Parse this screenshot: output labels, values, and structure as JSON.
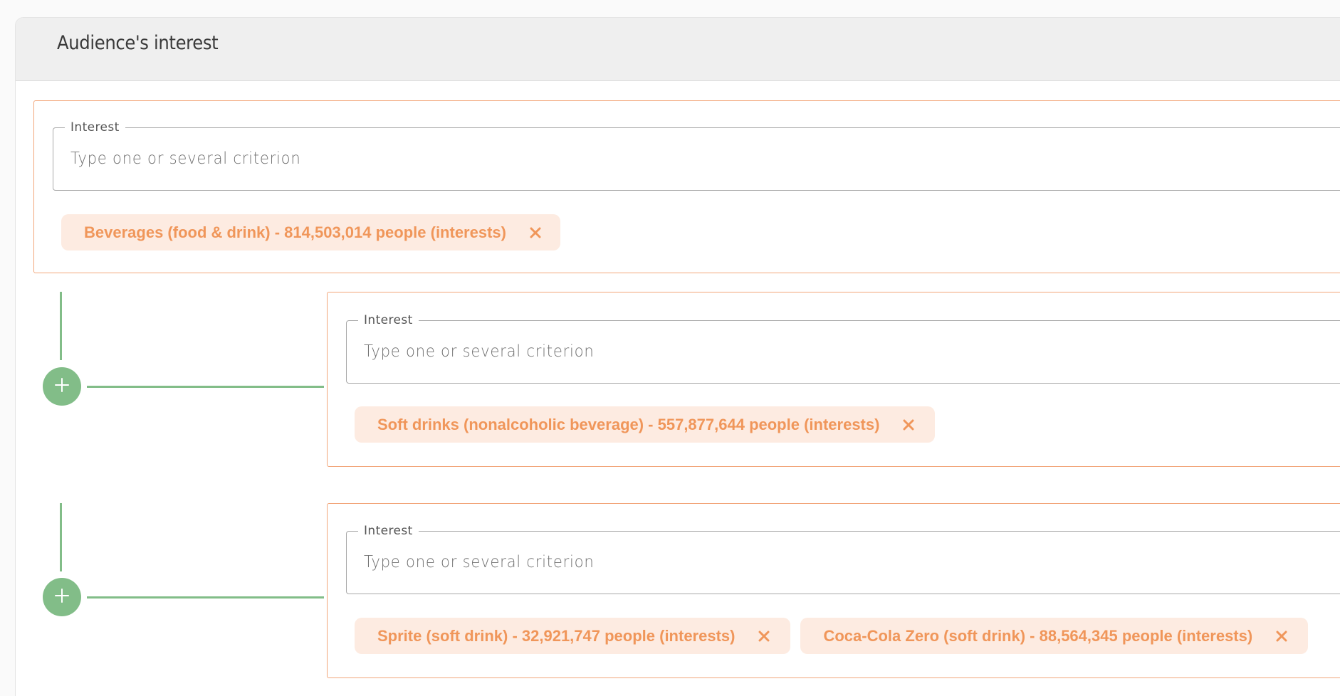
{
  "section": {
    "title": "Audience's interest"
  },
  "accent_color": "#f0965a",
  "connector_color": "#82bd88",
  "groups": [
    {
      "field_label": "Interest",
      "placeholder": "Type one or several criterion",
      "chips": [
        {
          "label": "Beverages (food & drink) - 814,503,014 people (interests)"
        }
      ]
    },
    {
      "field_label": "Interest",
      "placeholder": "Type one or several criterion",
      "chips": [
        {
          "label": "Soft drinks (nonalcoholic beverage) - 557,877,644 people (interests)"
        }
      ]
    },
    {
      "field_label": "Interest",
      "placeholder": "Type one or several criterion",
      "chips": [
        {
          "label": "Sprite (soft drink) - 32,921,747 people (interests)"
        },
        {
          "label": "Coca-Cola Zero (soft drink) - 88,564,345 people (interests)"
        }
      ]
    }
  ],
  "icons": {
    "add": "plus-icon",
    "remove": "close-icon"
  }
}
